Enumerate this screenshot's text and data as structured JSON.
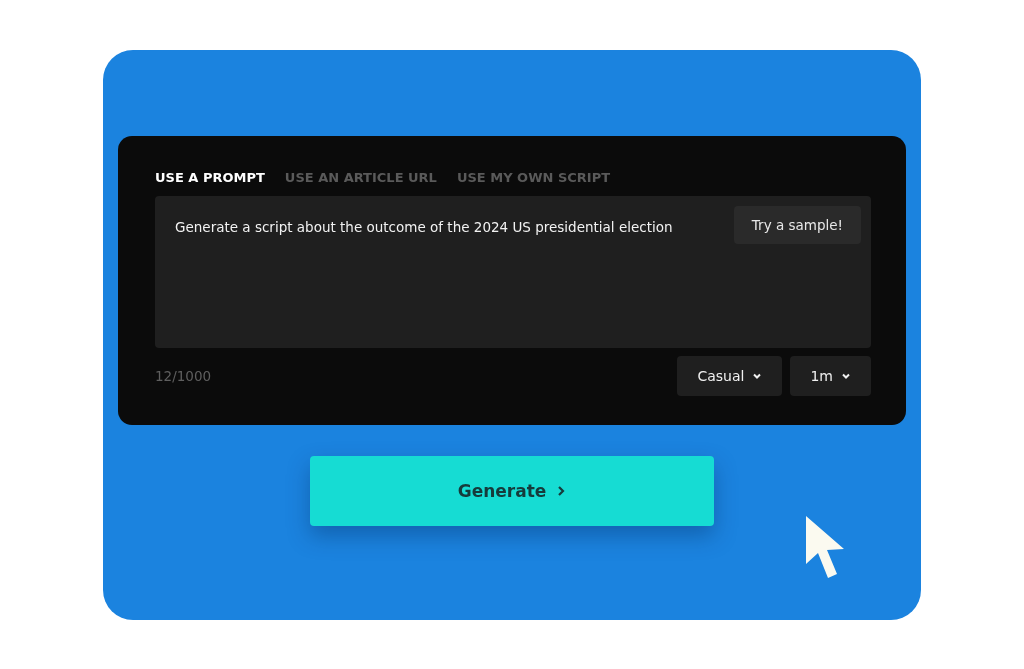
{
  "tabs": [
    {
      "label": "USE A PROMPT",
      "selected": true
    },
    {
      "label": "USE AN ARTICLE URL",
      "selected": false
    },
    {
      "label": "USE MY OWN SCRIPT",
      "selected": false
    }
  ],
  "prompt": {
    "value": "Generate a script about the outcome of the 2024 US presidential election"
  },
  "sample_button": "Try a sample!",
  "char_count": "12/1000",
  "dropdowns": [
    {
      "value": "Casual"
    },
    {
      "value": "1m"
    }
  ],
  "generate_button": "Generate"
}
